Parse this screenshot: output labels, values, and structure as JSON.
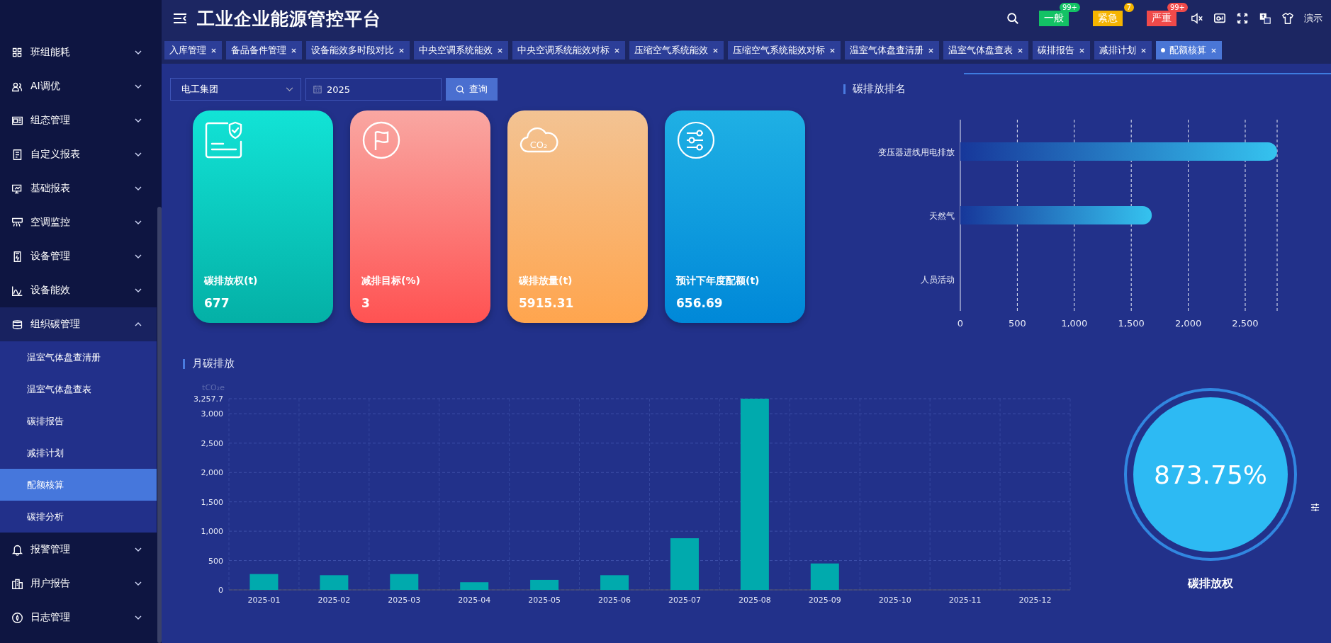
{
  "header": {
    "title": "工业企业能源管控平台",
    "alerts": [
      {
        "label": "一般",
        "count": "99+",
        "color": "#13c265"
      },
      {
        "label": "紧急",
        "count": "7",
        "color": "#f5b400"
      },
      {
        "label": "严重",
        "count": "99+",
        "color": "#f04a4a"
      }
    ],
    "user": "演示"
  },
  "sidebar": {
    "items": [
      {
        "label": "班组能耗",
        "expanded": false
      },
      {
        "label": "AI调优",
        "expanded": false
      },
      {
        "label": "组态管理",
        "expanded": false
      },
      {
        "label": "自定义报表",
        "expanded": false
      },
      {
        "label": "基础报表",
        "expanded": false
      },
      {
        "label": "空调监控",
        "expanded": false
      },
      {
        "label": "设备管理",
        "expanded": false
      },
      {
        "label": "设备能效",
        "expanded": false
      },
      {
        "label": "组织碳管理",
        "expanded": true,
        "children": [
          {
            "label": "温室气体盘查清册",
            "selected": false
          },
          {
            "label": "温室气体盘查表",
            "selected": false
          },
          {
            "label": "碳排报告",
            "selected": false
          },
          {
            "label": "减排计划",
            "selected": false
          },
          {
            "label": "配额核算",
            "selected": true
          },
          {
            "label": "碳排分析",
            "selected": false
          }
        ]
      },
      {
        "label": "报警管理",
        "expanded": false
      },
      {
        "label": "用户报告",
        "expanded": false
      },
      {
        "label": "日志管理",
        "expanded": false
      }
    ]
  },
  "tabs": [
    {
      "label": "入库管理",
      "selected": false
    },
    {
      "label": "备品备件管理",
      "selected": false
    },
    {
      "label": "设备能效多时段对比",
      "selected": false
    },
    {
      "label": "中央空调系统能效",
      "selected": false
    },
    {
      "label": "中央空调系统能效对标",
      "selected": false
    },
    {
      "label": "压缩空气系统能效",
      "selected": false
    },
    {
      "label": "压缩空气系统能效对标",
      "selected": false
    },
    {
      "label": "温室气体盘查清册",
      "selected": false
    },
    {
      "label": "温室气体盘查表",
      "selected": false
    },
    {
      "label": "碳排报告",
      "selected": false
    },
    {
      "label": "减排计划",
      "selected": false
    },
    {
      "label": "配额核算",
      "selected": true
    }
  ],
  "filters": {
    "company": "电工集团",
    "year": "2025",
    "query_button": "查询"
  },
  "cards": [
    {
      "kind": "allowance",
      "label": "碳排放权(t)",
      "value": "677"
    },
    {
      "kind": "target",
      "label": "减排目标(%)",
      "value": "3"
    },
    {
      "kind": "emission",
      "icon_text": "CO₂",
      "label": "碳排放量(t)",
      "value": "5915.31"
    },
    {
      "kind": "forecast",
      "label": "预计下年度配额(t)",
      "value": "656.69"
    }
  ],
  "ranking": {
    "title": "碳排放排名",
    "chart_data": {
      "type": "bar",
      "orientation": "horizontal",
      "categories": [
        "变压器进线用电排放",
        "天然气",
        "人员活动"
      ],
      "series": [
        {
          "color": "#35c3ef",
          "values": [
            2780,
            1680,
            0
          ]
        }
      ],
      "grid": true,
      "xlim": [
        0,
        2780
      ],
      "xticks": [
        0,
        500,
        {
          "value": 1000,
          "label": "1,000"
        },
        {
          "value": 1500,
          "label": "1,500"
        },
        {
          "value": 2000,
          "label": "2,000"
        },
        {
          "value": 2500,
          "label": "2,500"
        }
      ]
    }
  },
  "monthly": {
    "title": "月碳排放",
    "chart_data": {
      "type": "bar",
      "ylabel": "tCO₂e",
      "categories": [
        "2025-01",
        "2025-02",
        "2025-03",
        "2025-04",
        "2025-05",
        "2025-06",
        "2025-07",
        "2025-08",
        "2025-09",
        "2025-10",
        "2025-11",
        "2025-12"
      ],
      "series": [
        {
          "color": "#00aaad",
          "values": [
            270,
            250,
            270,
            130,
            170,
            250,
            880,
            3257.7,
            450,
            0,
            0,
            0
          ]
        }
      ],
      "grid": true,
      "ylim": [
        0,
        3257.7
      ],
      "yticks": [
        0,
        500,
        {
          "value": 1000,
          "label": "1,000"
        },
        {
          "value": 1500,
          "label": "1,500"
        },
        {
          "value": 2000,
          "label": "2,000"
        },
        {
          "value": 2500,
          "label": "2,500"
        },
        {
          "value": 3000,
          "label": "3,000"
        },
        {
          "value": 3257.7,
          "label": "3,257.7"
        }
      ]
    }
  },
  "gauge": {
    "value": "873.75%",
    "label": "碳排放权"
  }
}
